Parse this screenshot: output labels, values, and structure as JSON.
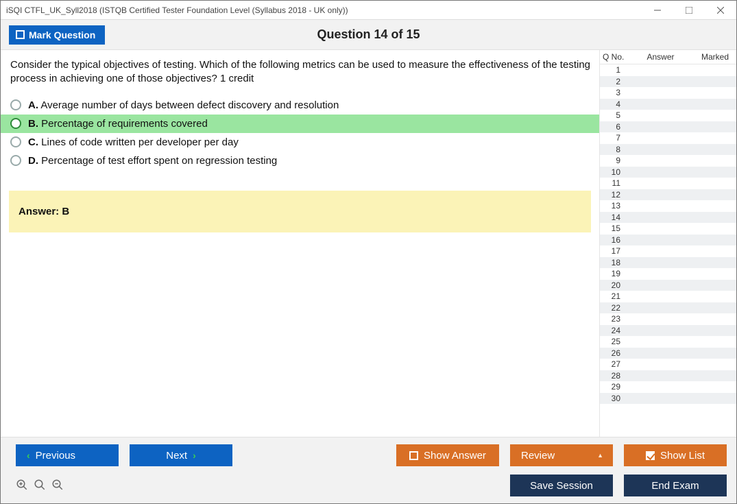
{
  "window": {
    "title": "iSQI CTFL_UK_Syll2018 (ISTQB Certified Tester Foundation Level (Syllabus 2018 - UK only))"
  },
  "header": {
    "mark_button": "Mark Question",
    "question_counter": "Question 14 of 15"
  },
  "question": {
    "text": "Consider the typical objectives of testing. Which of the following metrics can be used to measure the effectiveness of the testing process in achieving one of those objectives? 1 credit",
    "options": [
      {
        "letter": "A.",
        "text": "Average number of days between defect discovery and resolution",
        "highlighted": false
      },
      {
        "letter": "B.",
        "text": "Percentage of requirements covered",
        "highlighted": true
      },
      {
        "letter": "C.",
        "text": "Lines of code written per developer per day",
        "highlighted": false
      },
      {
        "letter": "D.",
        "text": "Percentage of test effort spent on regression testing",
        "highlighted": false
      }
    ],
    "answer_box": "Answer: B"
  },
  "qlist": {
    "headers": {
      "qno": "Q No.",
      "answer": "Answer",
      "marked": "Marked"
    },
    "rows": [
      {
        "n": "1"
      },
      {
        "n": "2"
      },
      {
        "n": "3"
      },
      {
        "n": "4"
      },
      {
        "n": "5"
      },
      {
        "n": "6"
      },
      {
        "n": "7"
      },
      {
        "n": "8"
      },
      {
        "n": "9"
      },
      {
        "n": "10"
      },
      {
        "n": "11"
      },
      {
        "n": "12"
      },
      {
        "n": "13"
      },
      {
        "n": "14"
      },
      {
        "n": "15"
      },
      {
        "n": "16"
      },
      {
        "n": "17"
      },
      {
        "n": "18"
      },
      {
        "n": "19"
      },
      {
        "n": "20"
      },
      {
        "n": "21"
      },
      {
        "n": "22"
      },
      {
        "n": "23"
      },
      {
        "n": "24"
      },
      {
        "n": "25"
      },
      {
        "n": "26"
      },
      {
        "n": "27"
      },
      {
        "n": "28"
      },
      {
        "n": "29"
      },
      {
        "n": "30"
      }
    ]
  },
  "footer": {
    "previous": "Previous",
    "next": "Next",
    "show_answer": "Show Answer",
    "review": "Review",
    "show_list": "Show List",
    "save_session": "Save Session",
    "end_exam": "End Exam"
  }
}
